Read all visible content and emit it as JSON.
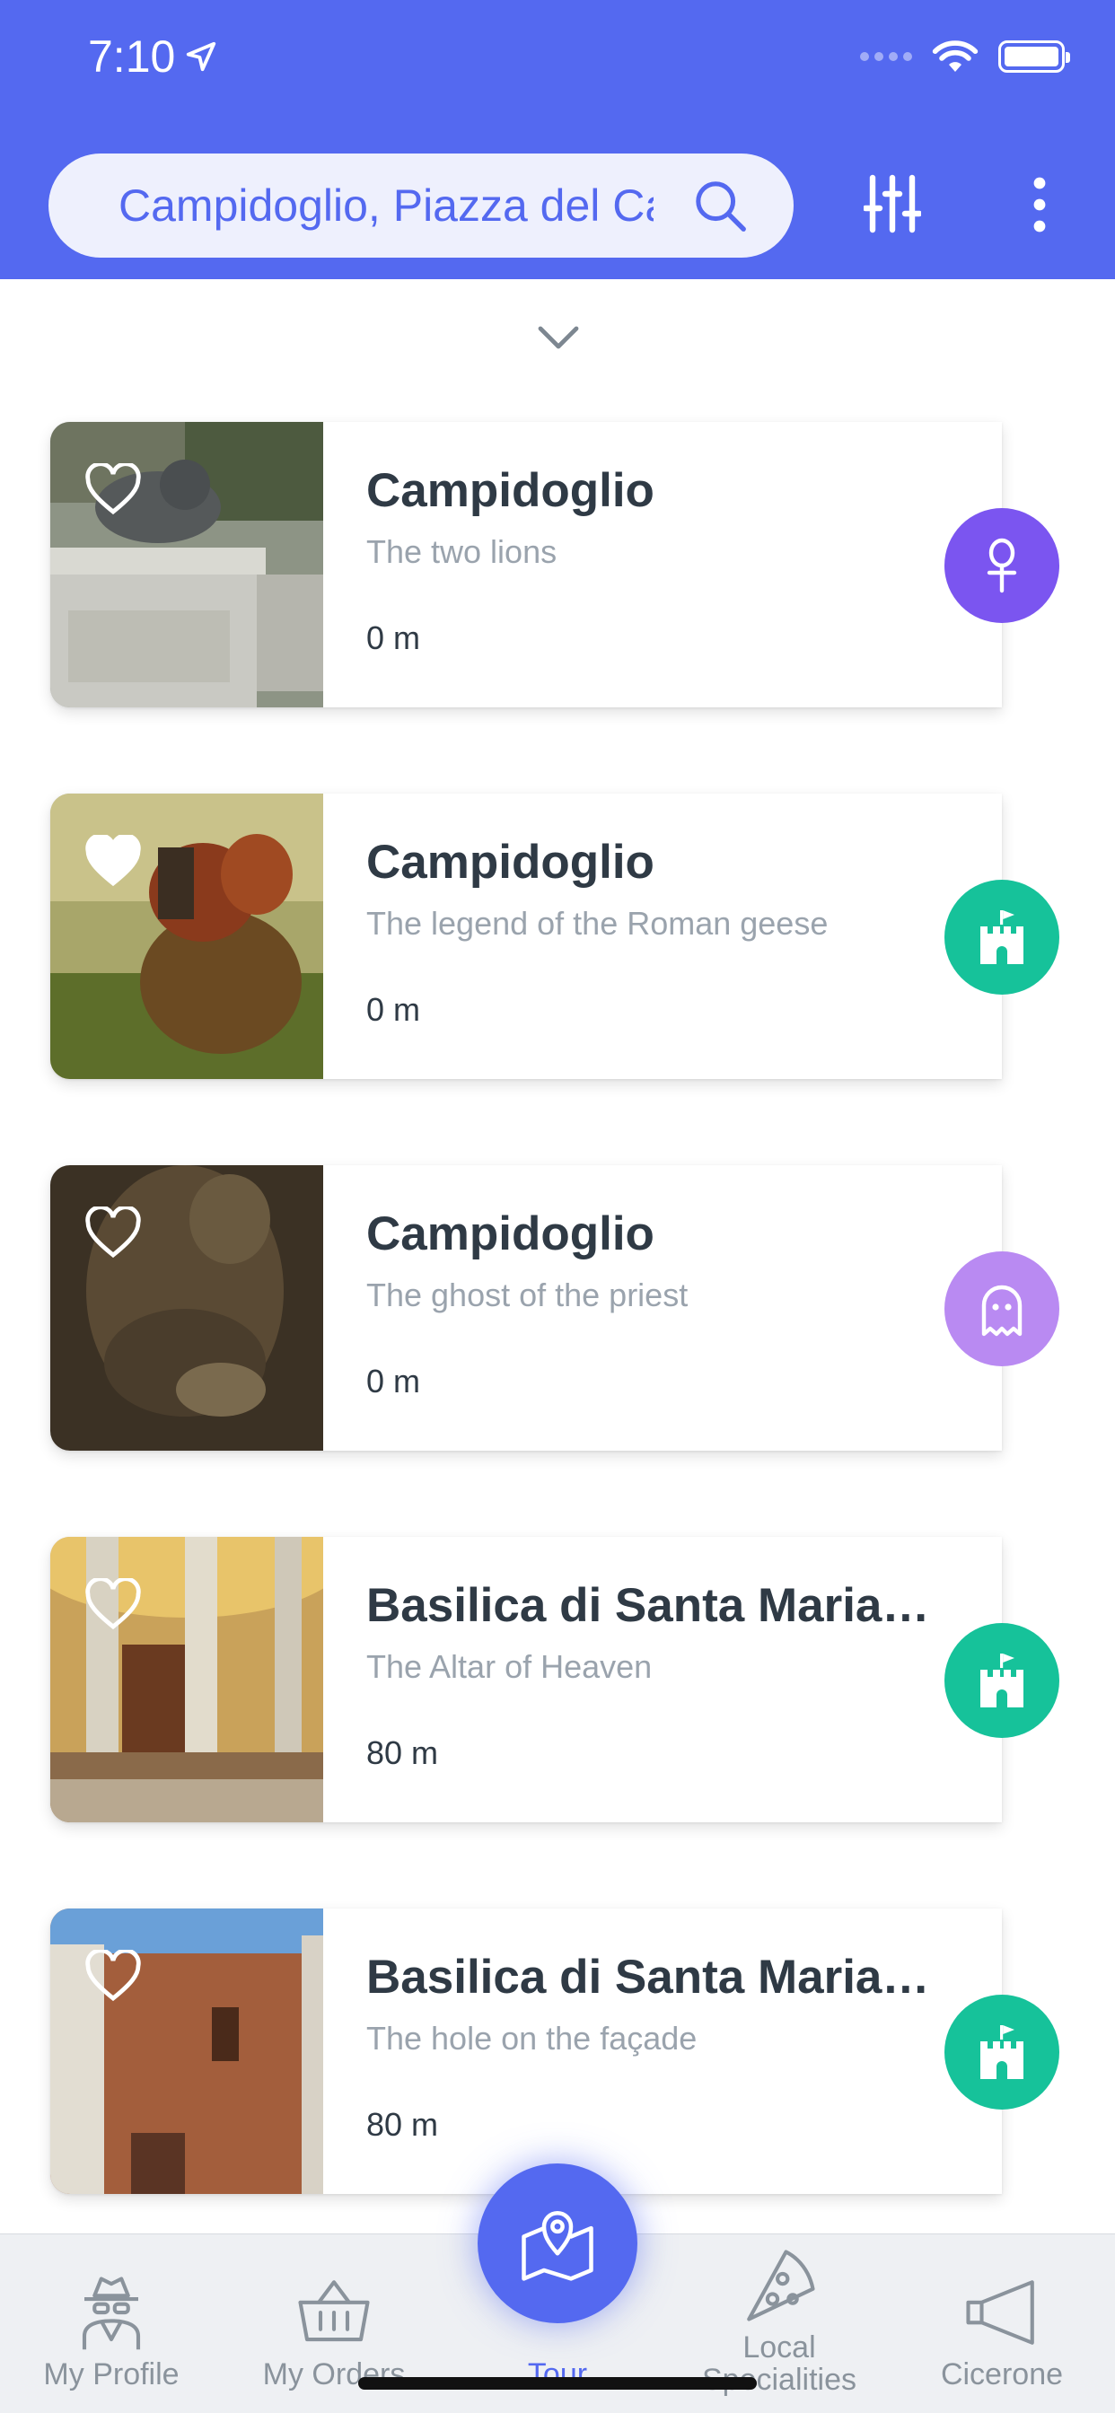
{
  "status_bar": {
    "time": "7:10"
  },
  "search": {
    "value": "Campidoglio, Piazza del Campidoglio"
  },
  "colors": {
    "primary": "#5469f0",
    "purple": "#7b55f0",
    "teal": "#16c29a",
    "lavender": "#b98af2"
  },
  "cards": [
    {
      "title": "Campidoglio",
      "subtitle": "The two lions",
      "distance": "0 m",
      "favorite": false,
      "category_icon": "ankh-icon",
      "badge_color": "#7b55f0"
    },
    {
      "title": "Campidoglio",
      "subtitle": "The legend of the Roman geese",
      "distance": "0 m",
      "favorite": true,
      "category_icon": "castle-icon",
      "badge_color": "#16c29a"
    },
    {
      "title": "Campidoglio",
      "subtitle": "The ghost of the priest",
      "distance": "0 m",
      "favorite": false,
      "category_icon": "ghost-icon",
      "badge_color": "#b98af2"
    },
    {
      "title": "Basilica di Santa Maria…",
      "subtitle": "The Altar of Heaven",
      "distance": "80 m",
      "favorite": false,
      "category_icon": "castle-icon",
      "badge_color": "#16c29a"
    },
    {
      "title": "Basilica di Santa Maria…",
      "subtitle": "The hole on the façade",
      "distance": "80 m",
      "favorite": false,
      "category_icon": "castle-icon",
      "badge_color": "#16c29a"
    }
  ],
  "nav": {
    "profile": "My Profile",
    "orders": "My Orders",
    "tour": "Tour",
    "local_line1": "Local",
    "local_line2": "Specialities",
    "cicerone": "Cicerone"
  }
}
